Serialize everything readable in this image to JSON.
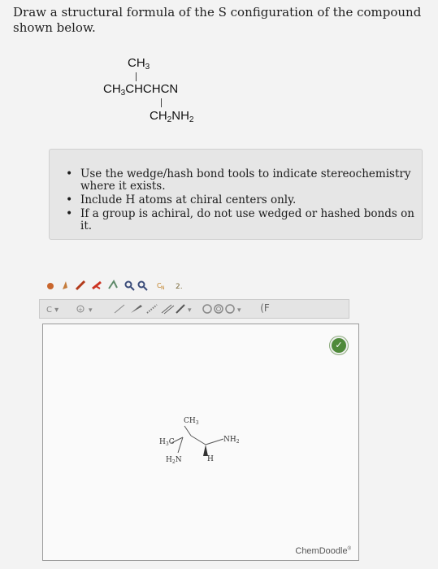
{
  "question": {
    "text": "Draw a structural formula of the S configuration of the compound shown below."
  },
  "condensed_formula": {
    "top": "CH3",
    "middle": "CH3CHCHCN",
    "bottom": "CH2NH2"
  },
  "instructions": [
    "Use the wedge/hash bond tools to indicate stereochemistry where it exists.",
    "Include H atoms at chiral centers only.",
    "If a group is achiral, do not use wedged or hashed bonds on it."
  ],
  "toolbar": {
    "row2_text": "(F"
  },
  "canvas": {
    "atoms": {
      "ch3_top": "CH3",
      "h3c": "H3C",
      "nh2": "NH2",
      "h": "H",
      "h2n": "H2N"
    },
    "brand": "ChemDoodle"
  },
  "colors": {
    "check_button": "#4f8a3a",
    "background": "#f3f3f3"
  }
}
